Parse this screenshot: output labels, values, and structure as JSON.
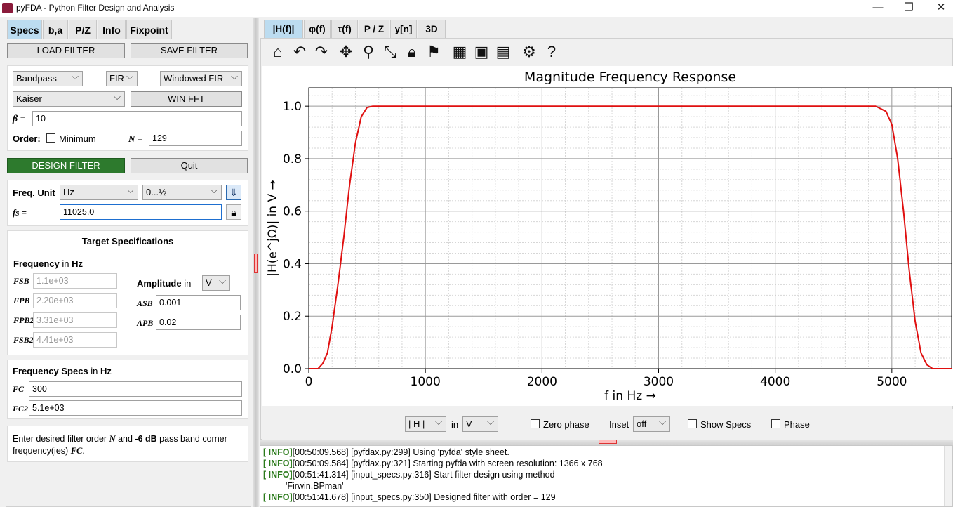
{
  "window": {
    "title": "pyFDA - Python Filter Design and Analysis",
    "controls": {
      "minimize": "—",
      "restore": "❐",
      "close": "✕"
    }
  },
  "left_tabs": [
    "Specs",
    "b,a",
    "P/Z",
    "Info",
    "Fixpoint"
  ],
  "file_buttons": {
    "load": "LOAD FILTER",
    "save": "SAVE FILTER"
  },
  "filter_select": {
    "response_type": "Bandpass",
    "filter_type": "FIR",
    "design_method": "Windowed FIR",
    "window": "Kaiser",
    "win_fft_label": "WIN FFT",
    "beta_label": "β =",
    "beta_value": "10",
    "order_label": "Order:",
    "minimum_label": "Minimum",
    "minimum_checked": false,
    "n_label": "N =",
    "n_value": "129"
  },
  "actions": {
    "design": "DESIGN FILTER",
    "quit": "Quit"
  },
  "freq_settings": {
    "unit_label": "Freq. Unit",
    "unit": "Hz",
    "range": "0...½",
    "fs_label": "fs =",
    "fs_value": "11025.0"
  },
  "target_specs": {
    "title": "Target Specifications",
    "freq_label": "Frequency",
    "freq_in": "in",
    "freq_unit": "Hz",
    "freq_fields": [
      {
        "label": "FSB",
        "value": "1.1e+03"
      },
      {
        "label": "FPB",
        "value": "2.20e+03"
      },
      {
        "label": "FPB2",
        "value": "3.31e+03"
      },
      {
        "label": "FSB2",
        "value": "4.41e+03"
      }
    ],
    "amp_label": "Amplitude",
    "amp_in": "in",
    "amp_unit": "V",
    "amp_fields": [
      {
        "label": "ASB",
        "value": "0.001"
      },
      {
        "label": "APB",
        "value": "0.02"
      }
    ]
  },
  "freq_specs": {
    "title": "Frequency Specs",
    "in": "in",
    "unit": "Hz",
    "fields": [
      {
        "label": "FC",
        "value": "300"
      },
      {
        "label": "FC2",
        "value": "5.1e+03"
      }
    ]
  },
  "info_text": {
    "part1": "Enter desired filter order",
    "n": "N",
    "part2": "and",
    "db": "-6 dB",
    "part3": "pass band corner frequency(ies)",
    "fc": "FC"
  },
  "right_tabs": [
    "|H(f)|",
    "φ(f)",
    "τ(f)",
    "P / Z",
    "y[n]",
    "3D"
  ],
  "toolbar_icons": [
    "home-icon",
    "undo-icon",
    "redo-icon",
    "pan-icon",
    "zoom-icon",
    "fullscreen-icon",
    "lock-icon",
    "marker-icon",
    "grid-icon",
    "save-icon",
    "clipboard-icon",
    "settings-icon",
    "help-icon"
  ],
  "plot_controls": {
    "mag_select": "| H |",
    "in_label": "in",
    "unit_select": "V",
    "zero_phase_label": "Zero phase",
    "inset_label": "Inset",
    "inset_value": "off",
    "show_specs_label": "Show Specs",
    "phase_label": "Phase"
  },
  "chart_data": {
    "type": "line",
    "title": "Magnitude Frequency Response",
    "xlabel": "f in Hz →",
    "ylabel": "|H(e^jΩ)| in V →",
    "xlim": [
      0,
      5512.5
    ],
    "ylim": [
      0,
      1.07
    ],
    "xticks": [
      "0",
      "1000",
      "2000",
      "3000",
      "4000",
      "5000"
    ],
    "yticks": [
      "0.0",
      "0.2",
      "0.4",
      "0.6",
      "0.8",
      "1.0"
    ],
    "grid": true,
    "series": [
      {
        "color": "#e01010",
        "x": [
          0,
          80,
          120,
          160,
          200,
          250,
          300,
          350,
          400,
          450,
          500,
          550,
          4860,
          4950,
          5000,
          5050,
          5100,
          5150,
          5200,
          5250,
          5300,
          5350,
          5400,
          5450,
          5512.5
        ],
        "y": [
          0,
          0.0,
          0.02,
          0.06,
          0.16,
          0.32,
          0.5,
          0.7,
          0.86,
          0.96,
          0.995,
          1.0,
          1.0,
          0.98,
          0.93,
          0.8,
          0.6,
          0.37,
          0.18,
          0.06,
          0.015,
          0.0,
          0.0,
          0.0,
          0.0
        ]
      }
    ]
  },
  "log": [
    {
      "level": "[ INFO]",
      "text": "[00:50:09.568] [pyfdax.py:299] Using 'pyfda' style sheet."
    },
    {
      "level": "[ INFO]",
      "text": "[00:50:09.584] [pyfdax.py:321] Starting pyfda with screen resolution: 1366 x 768"
    },
    {
      "level": "[ INFO]",
      "text": "[00:51:41.314] [input_specs.py:316] Start filter design using method"
    },
    {
      "level": "",
      "text": "'Firwin.BPman'"
    },
    {
      "level": "[ INFO]",
      "text": "[00:51:41.678] [input_specs.py:350] Designed filter with order = 129"
    }
  ]
}
